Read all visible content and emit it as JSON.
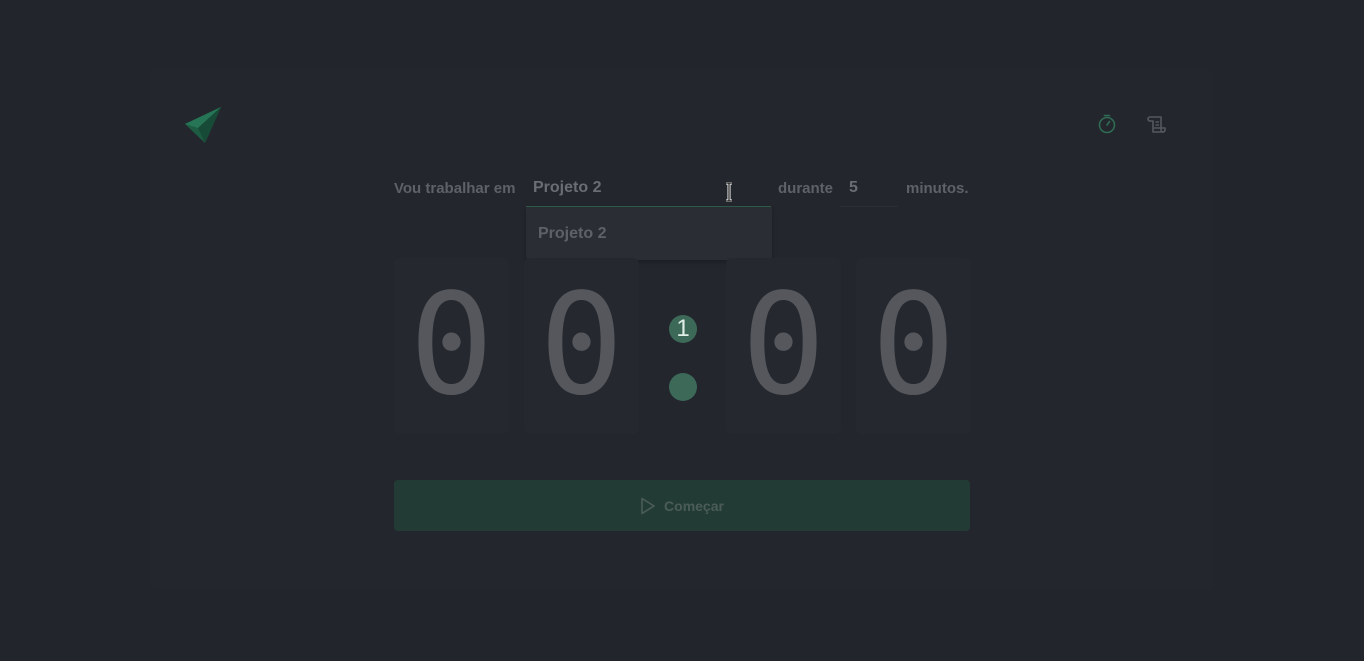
{
  "app": {
    "logo_icon": "paper-plane-logo",
    "accent_color": "#1f6b4e"
  },
  "nav": {
    "items": [
      {
        "icon": "timer-icon",
        "label": ""
      },
      {
        "icon": "scroll-history-icon",
        "label": ""
      }
    ]
  },
  "form": {
    "prefix": "Vou trabalhar em",
    "task_value": "Projeto 2",
    "middle": "durante",
    "minutes_value": "5",
    "suffix": "minutos."
  },
  "suggestions": {
    "options": [
      "Projeto 2"
    ]
  },
  "countdown": {
    "digits": [
      "0",
      "0",
      "0",
      "0"
    ],
    "badge": "1"
  },
  "start_button": {
    "label": "Começar",
    "icon": "play-icon"
  }
}
